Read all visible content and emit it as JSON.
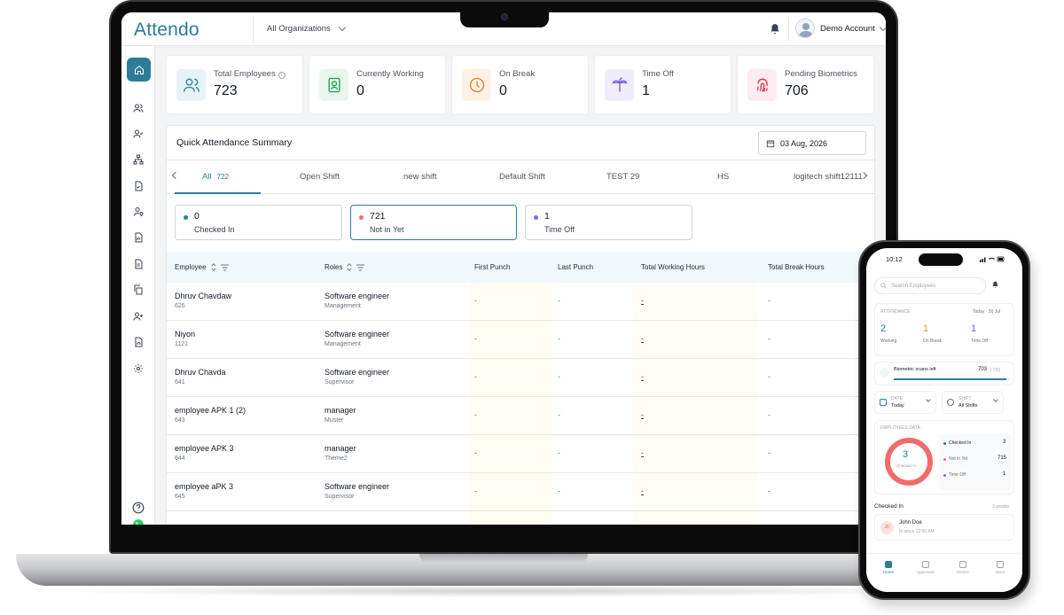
{
  "brand": {
    "logo": "Attendo",
    "accent": "#2b7c97"
  },
  "header": {
    "org_select": "All Organizations",
    "account_name": "Demo Account"
  },
  "sidebar": {
    "items": [
      "home-icon",
      "users-icon",
      "user-check-icon",
      "org-tree-icon",
      "document-check-icon",
      "user-location-icon",
      "report-icon",
      "file-icon",
      "copy-icon",
      "user-add-icon",
      "fingerprint-doc-icon",
      "settings-icon"
    ],
    "bottom": [
      "help-icon",
      "whatsapp-icon"
    ]
  },
  "stats": [
    {
      "label": "Total Employees",
      "value": "723",
      "icon": "users-icon",
      "color": "#2b7c97",
      "bg": "#e7f3f7"
    },
    {
      "label": "Currently Working",
      "value": "0",
      "icon": "badge-icon",
      "color": "#16a34a",
      "bg": "#e8f6ed"
    },
    {
      "label": "On Break",
      "value": "0",
      "icon": "clock-icon",
      "color": "#ea7c1f",
      "bg": "#fdf1e5"
    },
    {
      "label": "Time Off",
      "value": "1",
      "icon": "palm-tree-icon",
      "color": "#7c5cd6",
      "bg": "#f0ecfb"
    },
    {
      "label": "Pending Biometrics",
      "value": "706",
      "icon": "fingerprint-icon",
      "color": "#dc2f4f",
      "bg": "#fdecef"
    }
  ],
  "summary": {
    "title": "Quick Attendance Summary",
    "date": "03 Aug, 2026",
    "tabs": [
      {
        "label": "All",
        "count": "722"
      },
      {
        "label": "Open Shift"
      },
      {
        "label": "new shift"
      },
      {
        "label": "Default Shift"
      },
      {
        "label": "TEST 29"
      },
      {
        "label": "HS"
      },
      {
        "label": "logitech shift12111"
      }
    ],
    "status_cards": [
      {
        "count": "0",
        "label": "Checked In",
        "color": "#2b7c97"
      },
      {
        "count": "721",
        "label": "Not in Yet",
        "color": "#f26b6b"
      },
      {
        "count": "1",
        "label": "Time Off",
        "color": "#8b5cf6"
      }
    ]
  },
  "table": {
    "columns": [
      "Employee",
      "Roles",
      "First Punch",
      "Last Punch",
      "Total Working Hours",
      "Total Break Hours"
    ],
    "rows": [
      {
        "name": "Dhruv Chavdaw",
        "id": "626",
        "role": "Software engineer",
        "dept": "Management",
        "first": "-",
        "last": "-",
        "work": "-",
        "brk": "-"
      },
      {
        "name": "Niyon",
        "id": "1121",
        "role": "Software engineer",
        "dept": "Management",
        "first": "-",
        "last": "-",
        "work": "-",
        "brk": "-"
      },
      {
        "name": "Dhruv Chavda",
        "id": "641",
        "role": "Software engineer",
        "dept": "Supervisor",
        "first": "-",
        "last": "-",
        "work": "-",
        "brk": "-"
      },
      {
        "name": "employee APK 1 (2)",
        "id": "643",
        "role": "manager",
        "dept": "Muster",
        "first": "-",
        "last": "-",
        "work": "-",
        "brk": "-"
      },
      {
        "name": "employee APK 3",
        "id": "644",
        "role": "manager",
        "dept": "Theme2",
        "first": "-",
        "last": "-",
        "work": "-",
        "brk": "-"
      },
      {
        "name": "employee aPK 3",
        "id": "645",
        "role": "Software engineer",
        "dept": "Supervisor",
        "first": "-",
        "last": "-",
        "work": "-",
        "brk": "-"
      }
    ]
  },
  "phone": {
    "time": "10:12",
    "search_placeholder": "Search Employees",
    "attendance_label": "ATTENDANCE",
    "attendance_date": "Today · 30 Jul",
    "stats": [
      {
        "value": "2",
        "label": "Working",
        "color": "#2b7c97"
      },
      {
        "value": "1",
        "label": "On Break",
        "color": "#d4a017"
      },
      {
        "value": "1",
        "label": "Time Off",
        "color": "#7c5cd6"
      }
    ],
    "biometric_label": "Biometric scans left",
    "biometric_value": "703",
    "biometric_total": "/ 720",
    "biometric_fraction": 0.976,
    "date_label": "DATE",
    "date_value": "Today",
    "shift_label": "SHIFT",
    "shift_value": "All Shifts",
    "employees_data_label": "EMPLOYEES DATA",
    "donut_value": "3",
    "donut_label": "Checked In",
    "legend": [
      {
        "label": "Checked In",
        "value": "3",
        "color": "#2b7c97"
      },
      {
        "label": "Not in Yet",
        "value": "715",
        "color": "#f26b6b"
      },
      {
        "label": "Time Off",
        "value": "1",
        "color": "#8b5cf6"
      }
    ],
    "checked_in_title": "Checked In",
    "checked_in_count": "3 people",
    "person_initials": "JD",
    "person_name": "John Doe",
    "person_time": "In since 12:00 AM",
    "nav": [
      "Home",
      "Approvals",
      "Device",
      "More"
    ]
  }
}
